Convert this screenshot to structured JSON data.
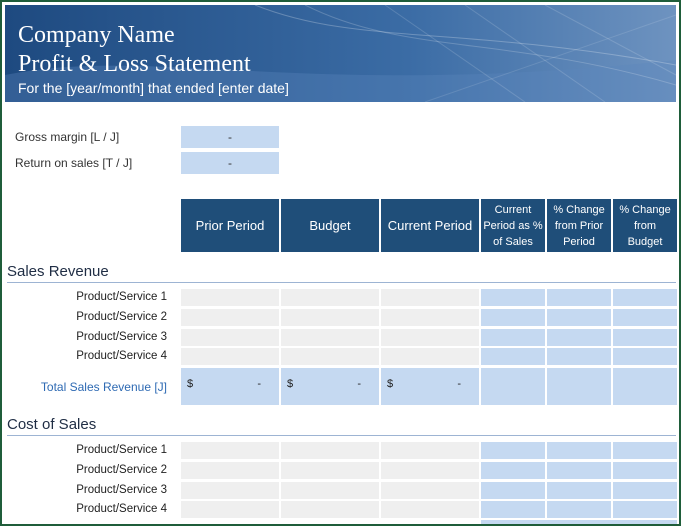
{
  "header": {
    "company_name": "Company Name",
    "title": "Profit & Loss Statement",
    "period_note": "For the [year/month] that ended [enter date]"
  },
  "metrics": [
    {
      "label": "Gross margin  [L / J]",
      "value": "-"
    },
    {
      "label": "Return on sales  [T / J]",
      "value": "-"
    }
  ],
  "columns": [
    "Prior Period",
    "Budget",
    "Current Period",
    [
      "Current",
      "Period as %",
      "of Sales"
    ],
    [
      "% Change",
      "from Prior",
      "Period"
    ],
    [
      "% Change",
      "from",
      "Budget"
    ]
  ],
  "sales_revenue": {
    "title": "Sales Revenue",
    "items": [
      "Product/Service 1",
      "Product/Service 2",
      "Product/Service 3",
      "Product/Service 4"
    ],
    "total_label": "Total Sales Revenue  [J]",
    "total_values": [
      {
        "currency": "$",
        "value": "-"
      },
      {
        "currency": "$",
        "value": "-"
      },
      {
        "currency": "$",
        "value": "-"
      }
    ]
  },
  "cost_of_sales": {
    "title": "Cost of Sales",
    "items": [
      "Product/Service 1",
      "Product/Service 2",
      "Product/Service 3",
      "Product/Service 4"
    ]
  },
  "colors": {
    "header_fill": "#1f4e79",
    "light_blue_cell": "#c5d9f1",
    "gray_cell": "#efefef",
    "total_text": "#2e6ab3",
    "frame_border": "#1f5d3a"
  }
}
